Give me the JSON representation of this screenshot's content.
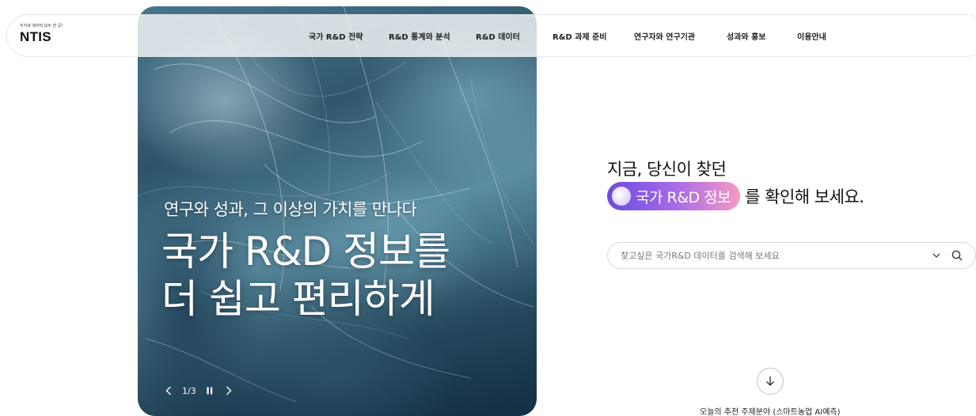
{
  "header": {
    "logo": {
      "tagline": "지식과 데이터 모두 한 곳!",
      "name": "NTIS"
    },
    "nav": [
      {
        "label": "국가 R&D 전략"
      },
      {
        "label": "R&D 통계와 분석"
      },
      {
        "label": "R&D 데이터"
      },
      {
        "label": "R&D 과제 준비"
      },
      {
        "label": "연구자와 연구기관"
      },
      {
        "label": "성과와 홍보"
      },
      {
        "label": "이용안내"
      }
    ]
  },
  "hero": {
    "subtitle": "연구와 성과, 그 이상의 가치를 만나다",
    "title_line1": "국가 R&D 정보를",
    "title_line2": "더 쉽고 편리하게",
    "pager": {
      "current": "1/3",
      "prev_icon": "chevron-left-icon",
      "pause_icon": "pause-icon",
      "next_icon": "chevron-right-icon"
    }
  },
  "main": {
    "lead_line1": "지금, 당신이 찾던",
    "highlight": "국가 R&D 정보",
    "lead_line2_rest": "를 확인해 보세요.",
    "search": {
      "placeholder": "찾고싶은 국가R&D 데이터를 검색해 보세요",
      "value": "",
      "dropdown_icon": "chevron-down-icon",
      "search_icon": "search-icon"
    },
    "scroll_icon": "arrow-down-icon",
    "recommend_text": "오늘의 추천 주제분야 (스마트농업 AI예측)"
  },
  "colors": {
    "pill_gradient_start": "#6b4be0",
    "pill_gradient_end": "#f59ac2",
    "hero_base": "#2a5368"
  }
}
